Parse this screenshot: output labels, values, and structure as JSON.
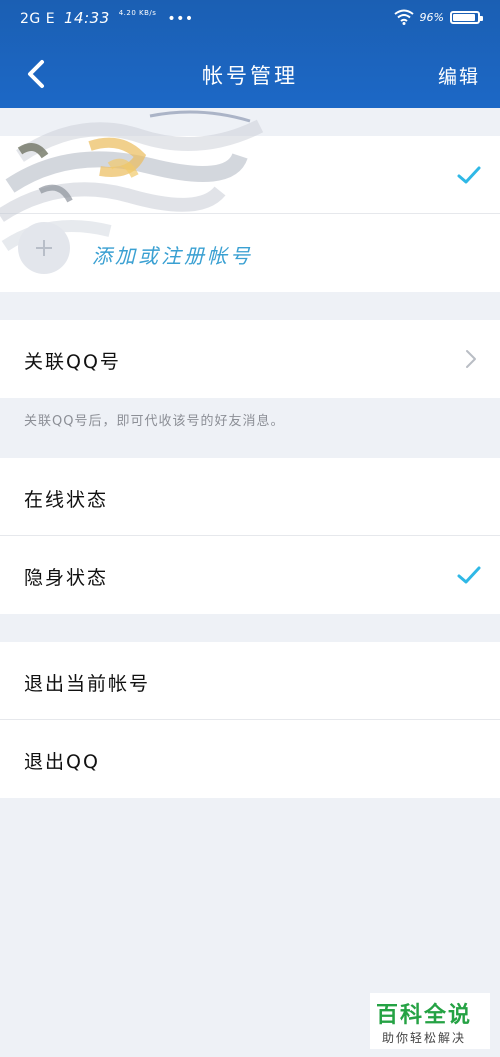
{
  "status_bar": {
    "network": "2G E",
    "time": "14:33",
    "speed": "4.20 KB/s",
    "dots": "•••",
    "battery": "96%"
  },
  "header": {
    "title": "帐号管理",
    "edit_label": "编辑"
  },
  "accounts": {
    "add_label": "添加或注册帐号"
  },
  "linked_qq": {
    "label": "关联QQ号",
    "hint": "关联QQ号后，即可代收该号的好友消息。"
  },
  "status": {
    "online_label": "在线状态",
    "invisible_label": "隐身状态"
  },
  "logout": {
    "current_label": "退出当前帐号",
    "qq_label": "退出QQ"
  },
  "watermark": {
    "title": "百科全说",
    "subtitle": "助你轻松解决"
  },
  "colors": {
    "header_blue": "#1c68c6",
    "check_cyan": "#2fb8e6",
    "background": "#eef1f6"
  }
}
